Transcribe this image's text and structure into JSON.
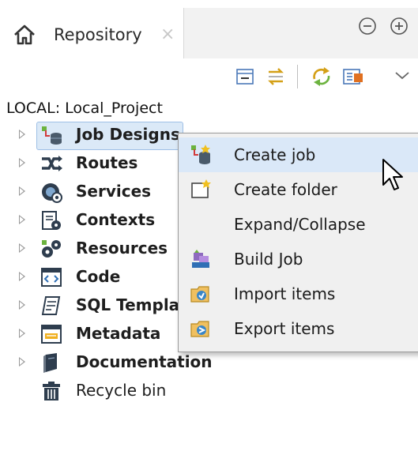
{
  "tab": {
    "title": "Repository",
    "close_glyph": "×"
  },
  "icons": {
    "home": "home-icon",
    "minimize": "minimize-icon",
    "maximize": "maximize-icon",
    "collapse_all": "collapse-all-icon",
    "link_editor": "link-with-editor-icon",
    "refresh": "refresh-icon",
    "filter": "filter-icon",
    "view_menu": "view-menu-chevron-icon"
  },
  "project": {
    "label": "LOCAL: Local_Project"
  },
  "tree": [
    {
      "label": "Job Designs",
      "bold": true,
      "icon": "job-designs-icon",
      "expandable": true,
      "selected": true
    },
    {
      "label": "Routes",
      "bold": true,
      "icon": "routes-icon",
      "expandable": true
    },
    {
      "label": "Services",
      "bold": true,
      "icon": "services-icon",
      "expandable": true
    },
    {
      "label": "Contexts",
      "bold": true,
      "icon": "contexts-icon",
      "expandable": true
    },
    {
      "label": "Resources",
      "bold": true,
      "icon": "resources-icon",
      "expandable": true
    },
    {
      "label": "Code",
      "bold": true,
      "icon": "code-icon",
      "expandable": true
    },
    {
      "label": "SQL Templa",
      "bold": true,
      "icon": "sql-templates-icon",
      "expandable": true
    },
    {
      "label": "Metadata",
      "bold": true,
      "icon": "metadata-icon",
      "expandable": true
    },
    {
      "label": "Documentation",
      "bold": true,
      "icon": "documentation-icon",
      "expandable": true
    },
    {
      "label": "Recycle bin",
      "bold": false,
      "icon": "recycle-bin-icon",
      "expandable": false
    }
  ],
  "context_menu": [
    {
      "label": "Create job",
      "icon": "create-job-icon",
      "highlighted": true
    },
    {
      "label": "Create folder",
      "icon": "create-folder-icon"
    },
    {
      "label": "Expand/Collapse",
      "icon": ""
    },
    {
      "label": "Build Job",
      "icon": "build-job-icon"
    },
    {
      "label": "Import items",
      "icon": "import-items-icon"
    },
    {
      "label": "Export items",
      "icon": "export-items-icon"
    }
  ],
  "colors": {
    "selection_bg": "#dbe9f7",
    "menu_bg": "#f0f0f0",
    "menu_highlight": "#dae8f8",
    "accent_green": "#6cb33f",
    "accent_blue": "#2f6fb5"
  }
}
